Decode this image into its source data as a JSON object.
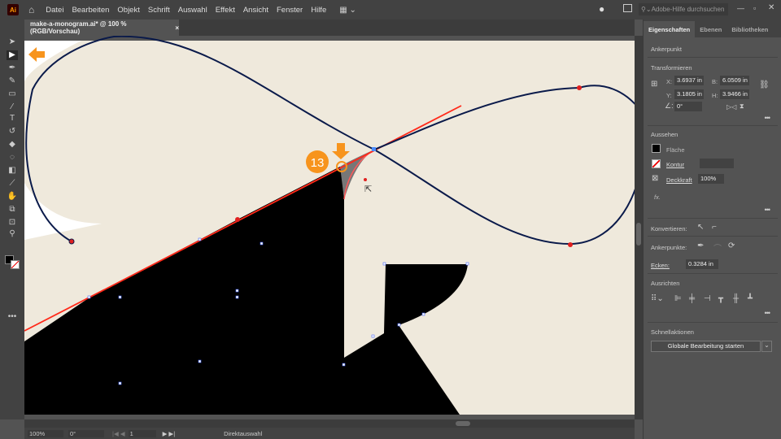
{
  "app": {
    "logo": "Ai",
    "menu": [
      "Datei",
      "Bearbeiten",
      "Objekt",
      "Schrift",
      "Auswahl",
      "Effekt",
      "Ansicht",
      "Fenster",
      "Hilfe"
    ],
    "search_placeholder": "Adobe-Hilfe durchsuchen"
  },
  "document": {
    "tab": "make-a-monogram.ai* @ 100 % (RGB/Vorschau)",
    "close": "×"
  },
  "annotation": {
    "step": "13",
    "accent": "#f7941d"
  },
  "colors": {
    "artboard": "#efe9dc",
    "path": "#0a1a4a",
    "guide": "#ff2a1a"
  },
  "panel": {
    "tabs": [
      "Eigenschaften",
      "Ebenen",
      "Bibliotheken"
    ],
    "selection": "Ankerpunkt",
    "transform": {
      "title": "Transformieren",
      "x_label": "X:",
      "x": "3.6937 in",
      "y_label": "Y:",
      "y": "3.1805 in",
      "w_label": "B:",
      "w": "6.0509 in",
      "h_label": "H:",
      "h": "3.9466 in",
      "angle": "0°"
    },
    "appearance": {
      "title": "Aussehen",
      "fill": "Fläche",
      "stroke": "Kontur",
      "opacity_label": "Deckkraft",
      "opacity": "100%",
      "fx": "fx."
    },
    "convert": "Konvertieren:",
    "anchors": "Ankerpunkte:",
    "corners_label": "Ecken:",
    "corners": "0.3284 in",
    "align": "Ausrichten",
    "quick": "Schnellaktionen",
    "quick_button": "Globale Bearbeitung starten",
    "more": "•••"
  },
  "status": {
    "zoom": "100%",
    "rotation": "0°",
    "artboard": "1",
    "tool": "Direktauswahl"
  }
}
